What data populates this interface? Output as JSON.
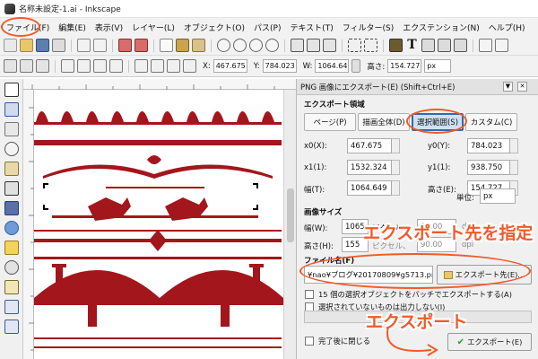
{
  "window": {
    "title": "名称未設定-1.ai - Inkscape"
  },
  "menu": [
    "ファイル(F)",
    "編集(E)",
    "表示(V)",
    "レイヤー(L)",
    "オブジェクト(O)",
    "パス(P)",
    "テキスト(T)",
    "フィルター(S)",
    "エクステンション(N)",
    "ヘルプ(H)"
  ],
  "coords": {
    "x_label": "X:",
    "x_value": "467.675",
    "y_label": "Y:",
    "y_value": "784.023",
    "w_label": "W:",
    "w_value": "1064.64",
    "h_label": "高さ:",
    "h_value": "154.727",
    "unit": "px"
  },
  "dialog": {
    "title": "PNG 画像にエクスポート(E) (Shift+Ctrl+E)",
    "export_area_label": "エクスポート領域",
    "tabs": [
      "ページ(P)",
      "描画全体(D)",
      "選択範囲(S)",
      "カスタム(C)"
    ],
    "active_tab": "選択範囲(S)",
    "x0_label": "x0(X):",
    "x0_value": "467.675",
    "y0_label": "y0(Y):",
    "y0_value": "784.023",
    "x1_label": "x1(1):",
    "x1_value": "1532.324",
    "y1_label": "y1(1):",
    "y1_value": "938.750",
    "width_label": "幅(T):",
    "width_value": "1064.649",
    "height_label": "高さ(E):",
    "height_value": "154.727",
    "unit_label": "単位:",
    "unit_value": "px",
    "image_size_label": "画像サイズ",
    "img_width_label": "幅(W):",
    "img_width_value": "1065",
    "img_width_dpi_label": "ピクセル、",
    "img_width_dpi_value": "90.00",
    "img_height_label": "高さ(H):",
    "img_height_value": "155",
    "img_height_dpi_label": "ピクセル、",
    "img_height_dpi_value": "90.00",
    "dpi_unit": "dpi",
    "filename_label": "ファイル名(F)",
    "filename_value": "¥nao¥ブログ¥20170809¥g5713.png",
    "export_as_button": "エクスポート先(E)...",
    "batch_label": "15 個の選択オブジェクトをバッチでエクスポートする(A)",
    "hide_unselected_label": "選択されていないものは出力しない(I)",
    "close_when_done_label": "完了後に閉じる",
    "export_button": "エクスポート(E)"
  },
  "annotations": {
    "export_dest": "エクスポート先を指定",
    "export": "エクスポート"
  },
  "colors": {
    "ornament": "#a3161c",
    "annotation": "#f15a29",
    "selected_tab": "#cfe0f4"
  }
}
